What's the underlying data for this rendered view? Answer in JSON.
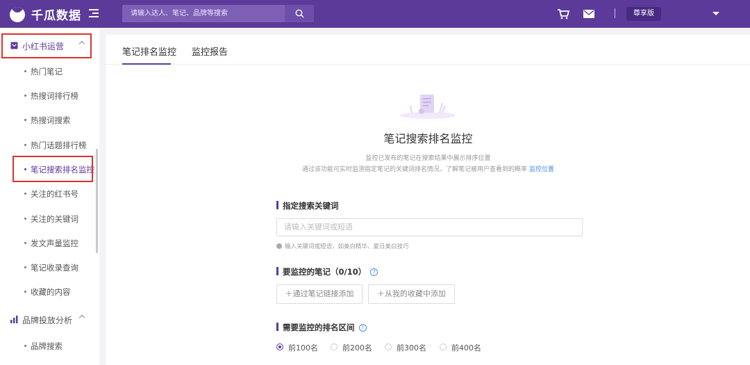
{
  "header": {
    "brand": "千瓜数据",
    "search_placeholder": "请输入达人、笔记、品牌等搜索",
    "vip_label": "尊享版"
  },
  "sidebar": {
    "group1": {
      "label": "小红书运营"
    },
    "items": [
      {
        "label": "热门笔记"
      },
      {
        "label": "热搜词排行榜"
      },
      {
        "label": "热搜词搜索"
      },
      {
        "label": "热门话题排行榜"
      },
      {
        "label": "笔记搜索排名监控"
      },
      {
        "label": "关注的红书号"
      },
      {
        "label": "关注的关键词"
      },
      {
        "label": "发文声量监控"
      },
      {
        "label": "笔记收录查询"
      },
      {
        "label": "收藏的内容"
      }
    ],
    "group2": {
      "label": "品牌投放分析"
    },
    "group2_items": [
      {
        "label": "品牌搜索"
      }
    ]
  },
  "tabs": [
    {
      "label": "笔记排名监控"
    },
    {
      "label": "监控报告"
    }
  ],
  "hero": {
    "title": "笔记搜索排名监控",
    "desc1": "监控已发布的笔记在搜索结果中展示排序位置",
    "desc2": "通过该功能可实时监测指定笔记的关键词排名情况，了解笔记被用户查看到的概率",
    "desc2_link": "监控位置"
  },
  "form": {
    "keyword_title": "指定搜索关键词",
    "keyword_placeholder": "请输入关键词或短语",
    "keyword_hint": "输入关键词或短语，如美白精华、夏日美白技巧",
    "notes_title": "要监控的笔记（0/10）",
    "add_by_link": "＋通过笔记链接添加",
    "add_from_fav": "＋从我的收藏中添加",
    "range_title": "需要监控的排名区间",
    "range_options": [
      "前100名",
      "前200名",
      "前300名",
      "前400名"
    ],
    "range_selected": "前100名"
  },
  "colors": {
    "brand_purple": "#5c3a9a",
    "highlight_red": "#e0302c",
    "link_blue": "#4a8ee0"
  }
}
